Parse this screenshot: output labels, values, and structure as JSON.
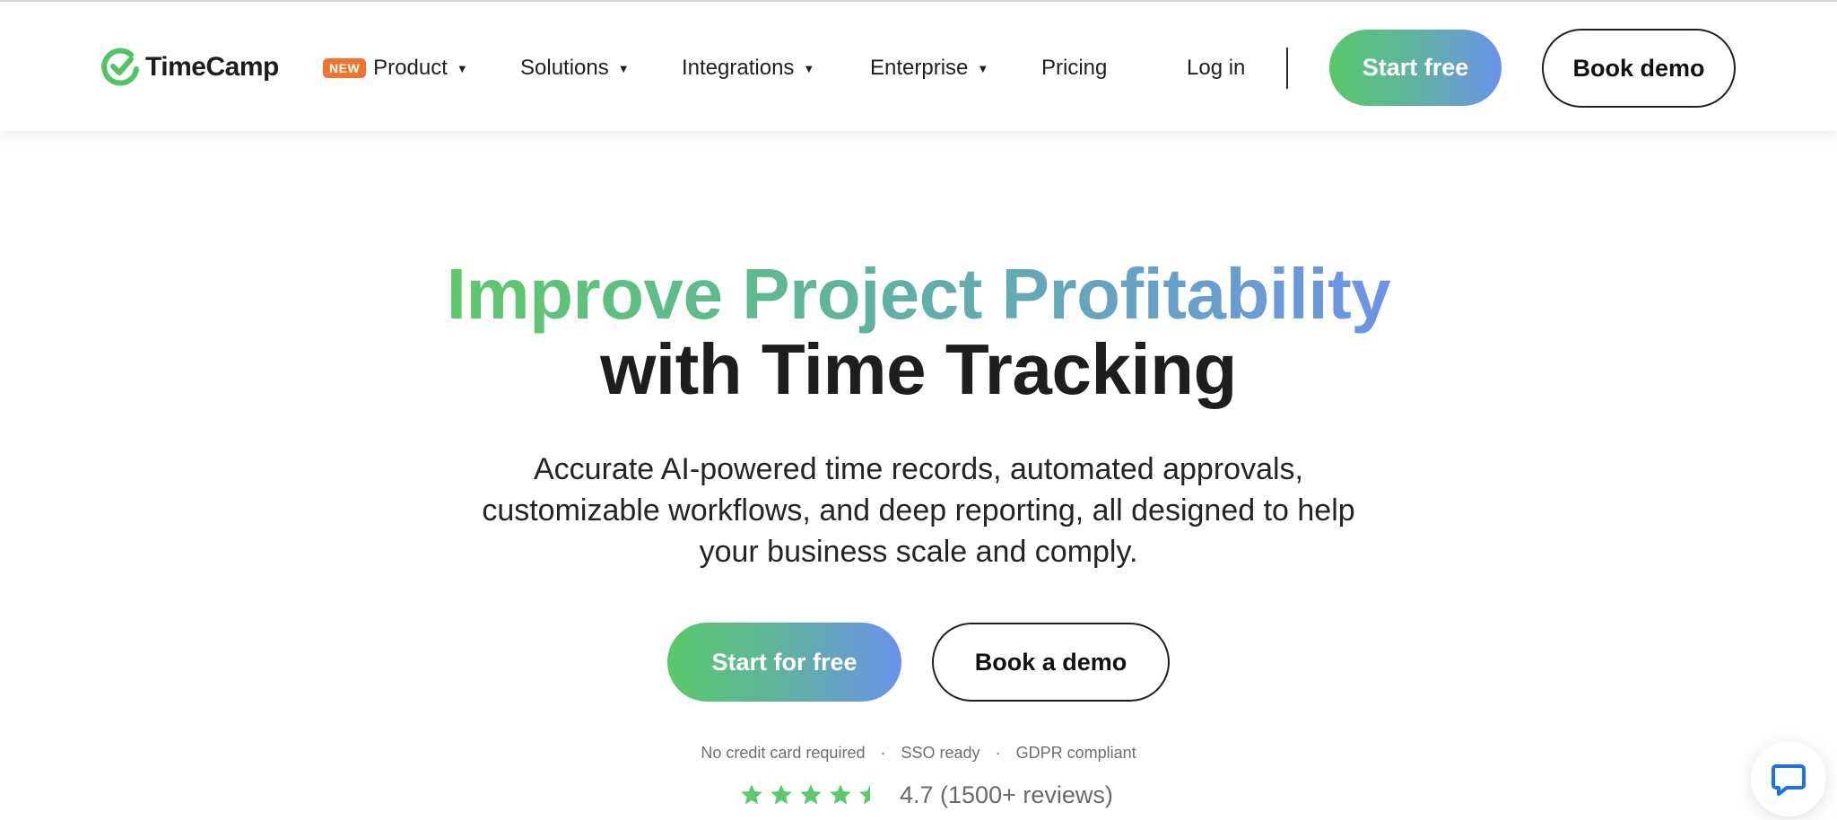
{
  "brand": {
    "name": "TimeCamp",
    "accent_green": "#59c96b",
    "accent_blue": "#6a92ea",
    "badge_color": "#f2742b"
  },
  "nav": {
    "new_badge": "NEW",
    "items": [
      {
        "label": "Product",
        "has_dropdown": true
      },
      {
        "label": "Solutions",
        "has_dropdown": true
      },
      {
        "label": "Integrations",
        "has_dropdown": true
      },
      {
        "label": "Enterprise",
        "has_dropdown": true
      },
      {
        "label": "Pricing",
        "has_dropdown": false
      }
    ],
    "login": "Log in",
    "start_free": "Start free",
    "book_demo": "Book demo"
  },
  "hero": {
    "title_highlight": "Improve Project Profitability",
    "title_rest": "with Time Tracking",
    "subtitle": "Accurate AI-powered time records, automated approvals, customizable workflows, and deep reporting, all designed to help your business scale and comply.",
    "cta_primary": "Start for free",
    "cta_secondary": "Book a demo"
  },
  "trust": {
    "items": [
      "No credit card required",
      "SSO ready",
      "GDPR compliant"
    ],
    "separator": "·"
  },
  "rating": {
    "stars": 4.5,
    "max_stars": 5,
    "text": "4.7 (1500+ reviews)",
    "star_color": "#5ec96a"
  },
  "chat_widget": {
    "icon": "chat-bubble-icon"
  }
}
